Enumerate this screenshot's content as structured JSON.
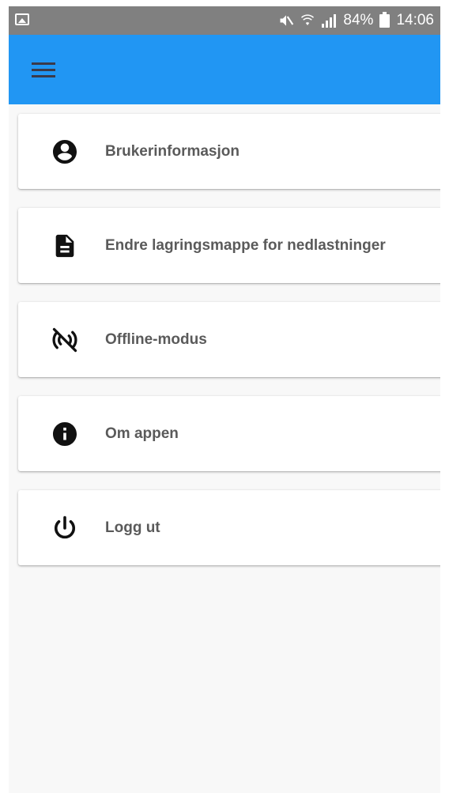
{
  "status_bar": {
    "battery_percent": "84%",
    "time": "14:06",
    "icons": [
      "gallery-icon",
      "mute-icon",
      "wifi-icon",
      "signal-icon",
      "battery-icon"
    ]
  },
  "app_bar": {
    "color": "#2196f3",
    "menu_icon": "hamburger-menu-icon"
  },
  "menu": {
    "items": [
      {
        "label": "Brukerinformasjon",
        "icon": "account-circle-icon"
      },
      {
        "label": "Endre lagringsmappe for nedlastninger",
        "icon": "document-icon"
      },
      {
        "label": "Offline-modus",
        "icon": "offline-icon"
      },
      {
        "label": "Om appen",
        "icon": "info-icon"
      },
      {
        "label": "Logg ut",
        "icon": "power-icon"
      }
    ]
  }
}
